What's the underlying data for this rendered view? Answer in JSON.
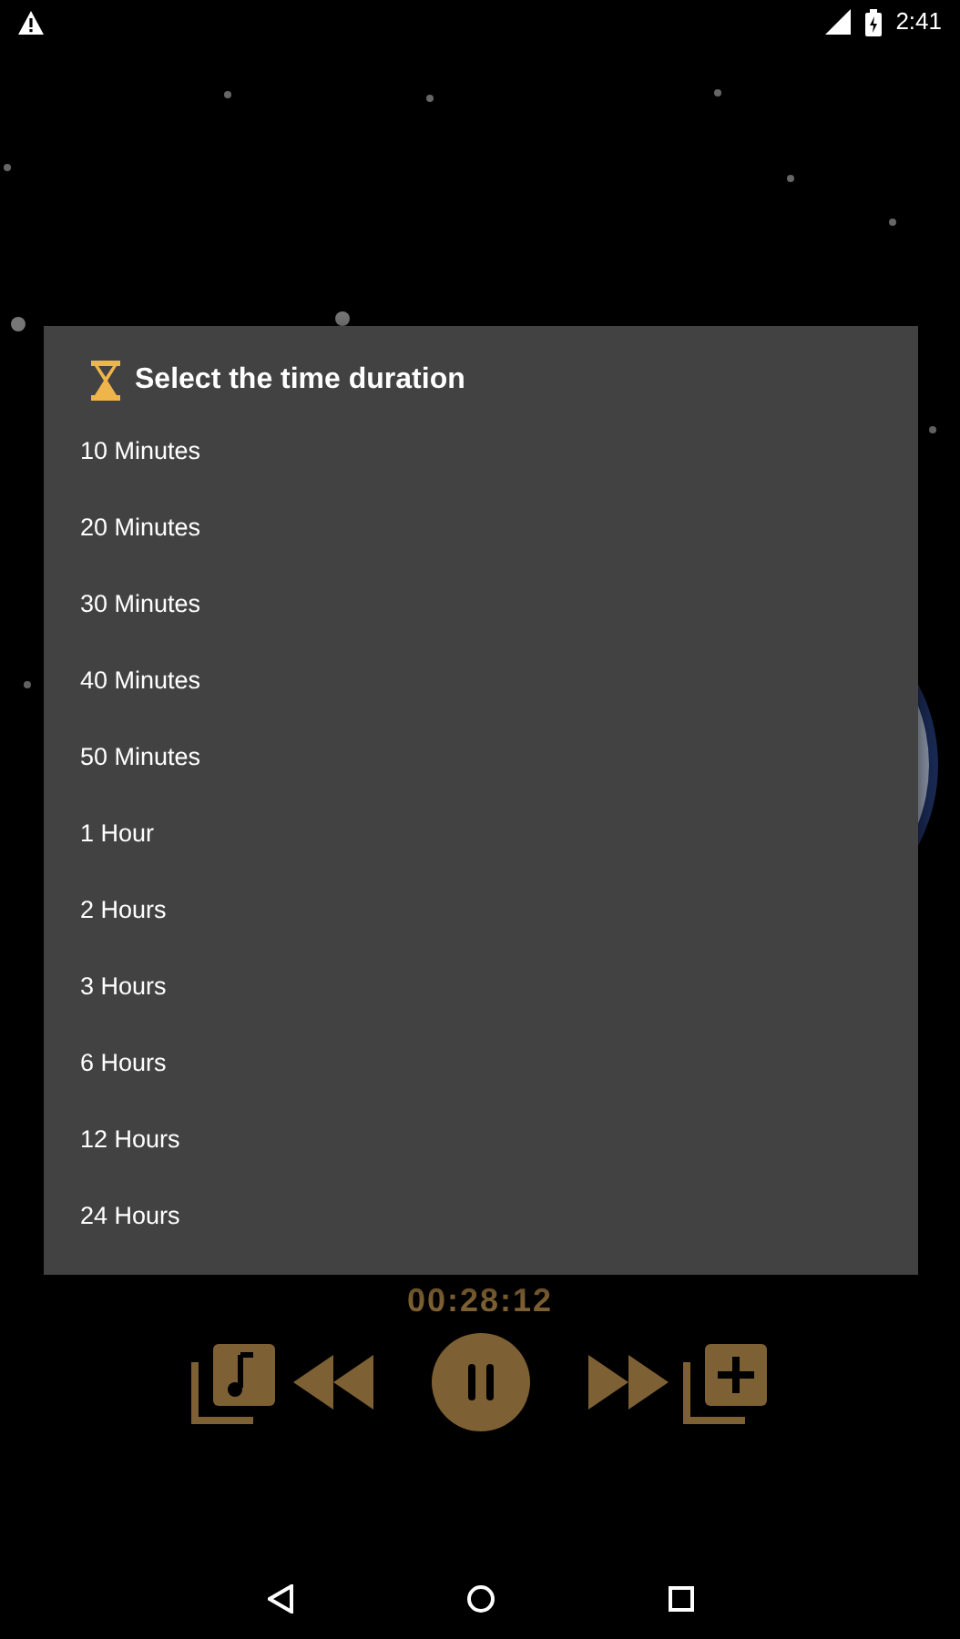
{
  "status_bar": {
    "time": "2:41"
  },
  "dialog": {
    "title": "Select the time duration",
    "options": [
      "10 Minutes",
      "20 Minutes",
      "30 Minutes",
      "40 Minutes",
      "50 Minutes",
      "1 Hour",
      "2 Hours",
      "3 Hours",
      "6 Hours",
      "12 Hours",
      "24 Hours"
    ]
  },
  "player": {
    "elapsed": "00:28:12"
  }
}
